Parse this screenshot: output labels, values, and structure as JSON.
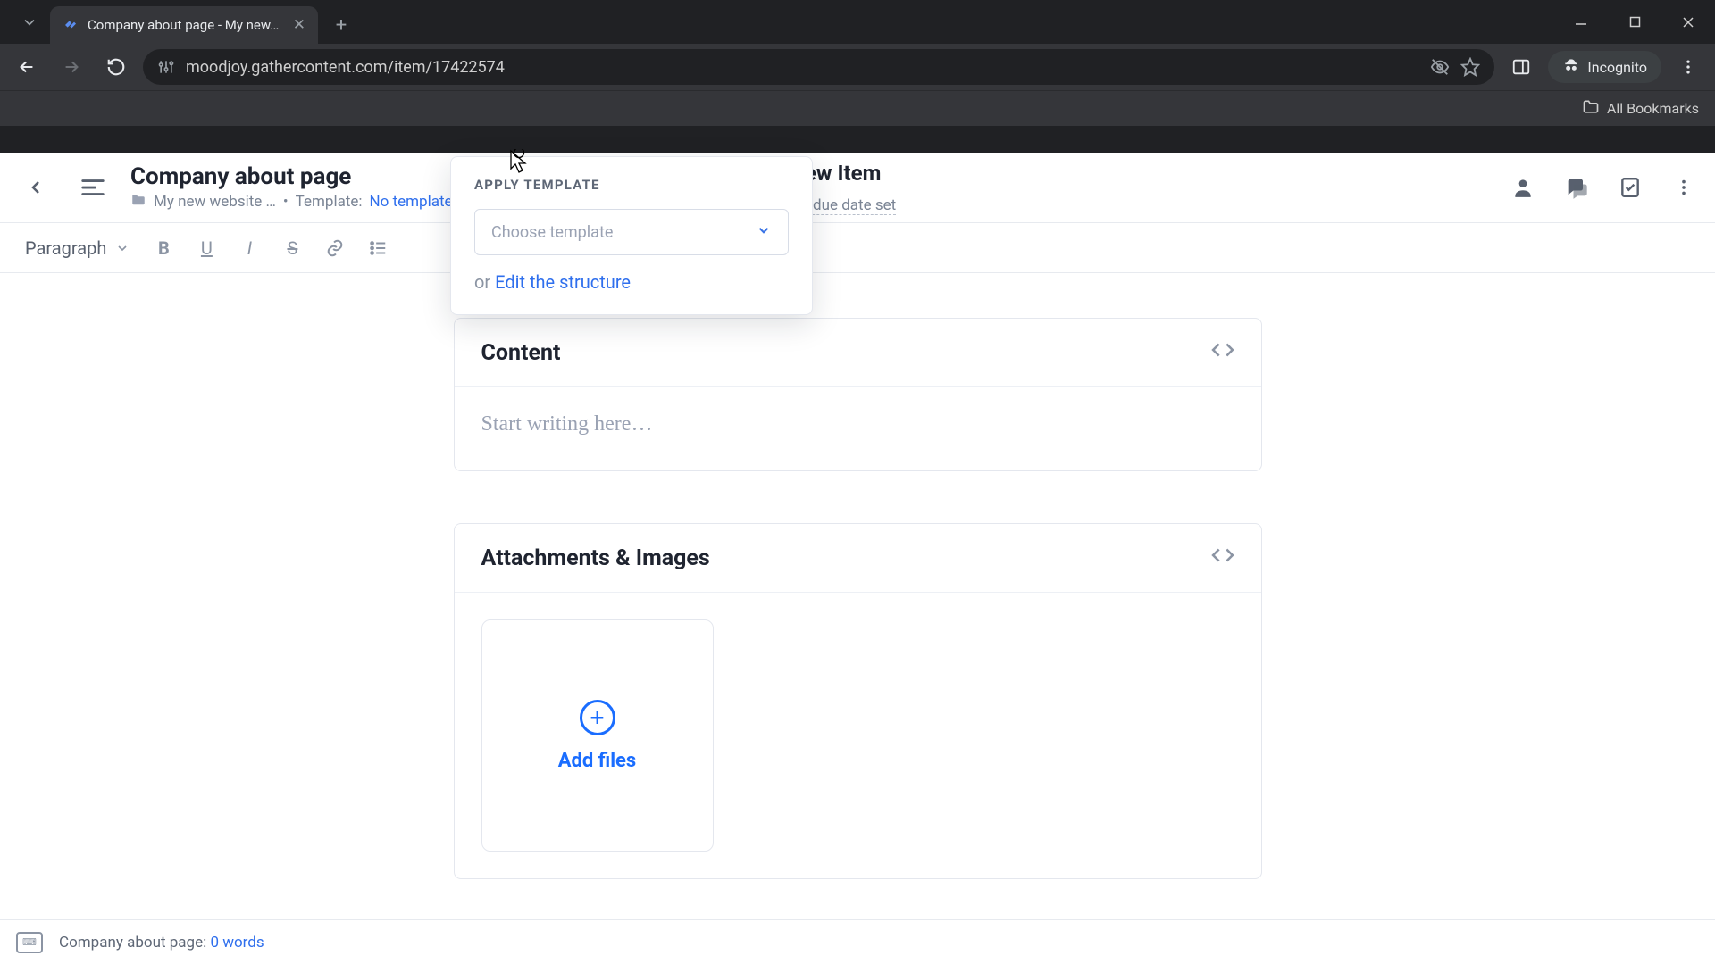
{
  "browser": {
    "tab_title": "Company about page - My new…",
    "url": "moodjoy.gathercontent.com/item/17422574",
    "incognito_label": "Incognito",
    "all_bookmarks": "All Bookmarks"
  },
  "header": {
    "title": "Company about page",
    "project": "My new website …",
    "template_label": "Template:",
    "template_value": "No template applied",
    "status_label": "New Item",
    "due_date": "No due date set"
  },
  "format_bar": {
    "paragraph": "Paragraph"
  },
  "popover": {
    "title": "APPLY TEMPLATE",
    "select_placeholder": "Choose template",
    "or_label": "or",
    "edit_link": "Edit the structure"
  },
  "content_card": {
    "title": "Content",
    "placeholder": "Start writing here…"
  },
  "attachments_card": {
    "title": "Attachments & Images",
    "add_files": "Add files"
  },
  "footer": {
    "label": "Company about page:",
    "count": "0 words"
  }
}
